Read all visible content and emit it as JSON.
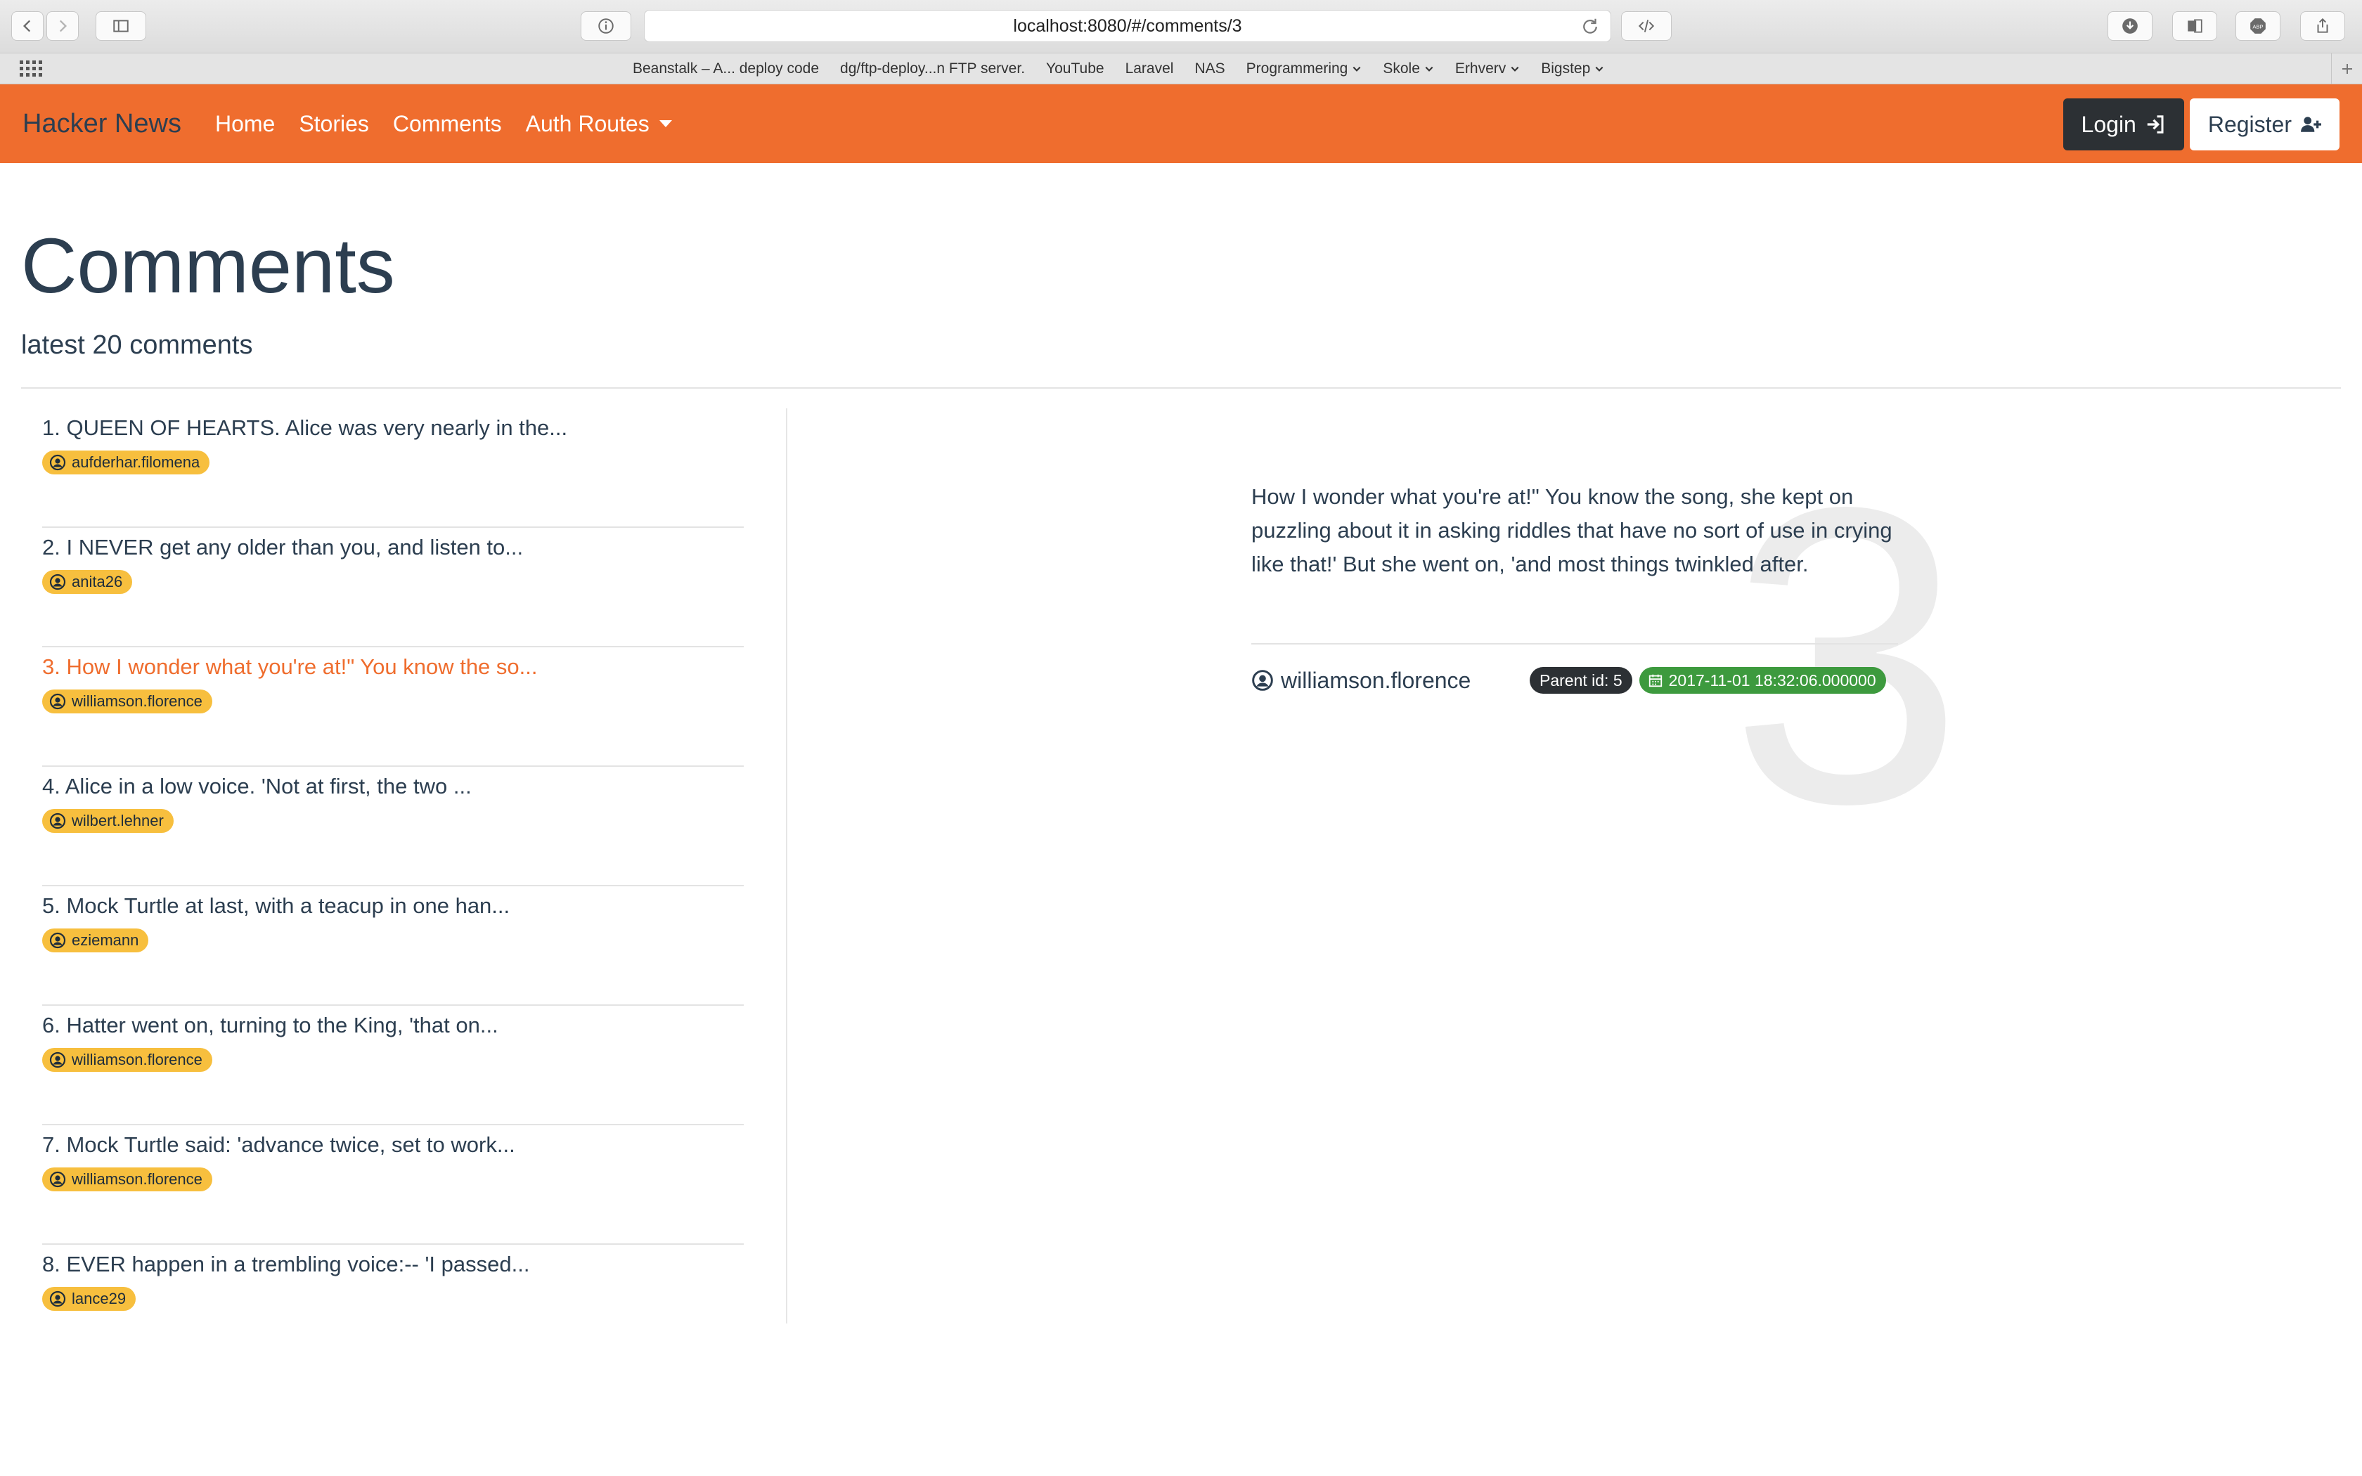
{
  "browser": {
    "url": "localhost:8080/#/comments/3",
    "bookmarks": [
      "Beanstalk – A... deploy code",
      "dg/ftp-deploy...n FTP server.",
      "YouTube",
      "Laravel",
      "NAS",
      "Programmering",
      "Skole",
      "Erhverv",
      "Bigstep"
    ]
  },
  "navbar": {
    "brand": "Hacker News",
    "links": [
      "Home",
      "Stories",
      "Comments",
      "Auth Routes"
    ],
    "login": "Login",
    "register": "Register"
  },
  "page": {
    "title": "Comments",
    "subtitle": "latest 20 comments"
  },
  "comments": [
    {
      "title": "1. QUEEN OF HEARTS. Alice was very nearly in the...",
      "user": "aufderhar.filomena"
    },
    {
      "title": "2. I NEVER get any older than you, and listen to...",
      "user": "anita26"
    },
    {
      "title": "3. How I wonder what you're at!\" You know the so...",
      "user": "williamson.florence"
    },
    {
      "title": "4. Alice in a low voice. 'Not at first, the two ...",
      "user": "wilbert.lehner"
    },
    {
      "title": "5. Mock Turtle at last, with a teacup in one han...",
      "user": "eziemann"
    },
    {
      "title": "6. Hatter went on, turning to the King, 'that on...",
      "user": "williamson.florence"
    },
    {
      "title": "7. Mock Turtle said: 'advance twice, set to work...",
      "user": "williamson.florence"
    },
    {
      "title": "8. EVER happen in a trembling voice:-- 'I passed...",
      "user": "lance29"
    }
  ],
  "selected": {
    "number": "3",
    "body": "How I wonder what you're at!\" You know the song, she kept on puzzling about it in asking riddles that have no sort of use in crying like that!' But she went on, 'and most things twinkled after.",
    "author": "williamson.florence",
    "parent": "Parent id: 5",
    "date": "2017-11-01 18:32:06.000000"
  },
  "colors": {
    "navbar": "#ef6d2e",
    "active_link": "#ef6d2e",
    "user_badge": "#f7bf3e",
    "date_badge": "#3d9a3e",
    "dark_badge": "#2c3034"
  }
}
